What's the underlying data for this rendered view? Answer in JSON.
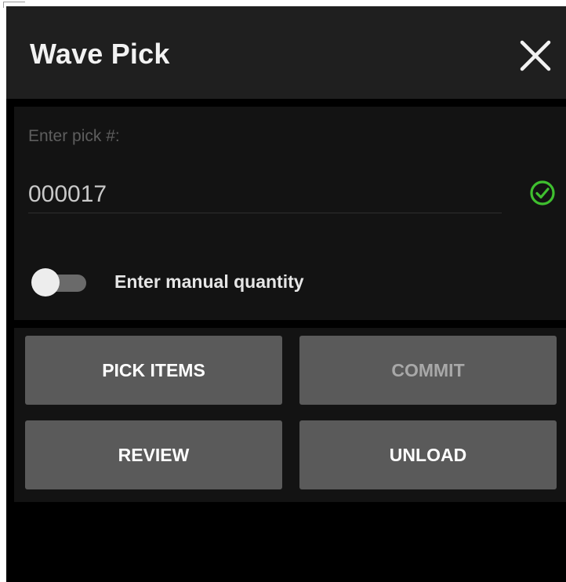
{
  "header": {
    "title": "Wave Pick",
    "close_icon": "close-icon"
  },
  "form": {
    "pick_label": "Enter pick #:",
    "pick_value": "000017",
    "valid_icon": "check-circle-icon",
    "manual_quantity": {
      "label": "Enter manual quantity",
      "enabled": false
    }
  },
  "actions": [
    {
      "label": "PICK ITEMS",
      "enabled": true
    },
    {
      "label": "COMMIT",
      "enabled": false
    },
    {
      "label": "REVIEW",
      "enabled": true
    },
    {
      "label": "UNLOAD",
      "enabled": true
    }
  ],
  "colors": {
    "header_bg": "#1f1f1f",
    "panel_bg": "#131313",
    "screen_bg": "#000000",
    "button_bg": "#5a5a5a",
    "valid_accent": "#3fbf2f",
    "disabled_text": "#a8a8a8"
  }
}
